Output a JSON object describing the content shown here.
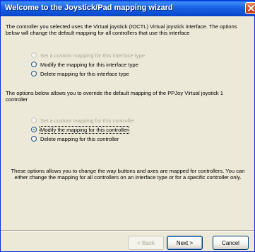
{
  "window": {
    "title": "Welcome to the Joystick/Pad mapping wizard"
  },
  "intro": {
    "text": "The controller you selected uses the Virtual joystick (IOCTL) Virtual joystick interface. The options below will change the default mapping for all controllers that use this interface"
  },
  "interface_options": [
    {
      "label": "Set a custom mapping for this interface type",
      "checked": false,
      "disabled": true
    },
    {
      "label": "Modify the mapping for this interface type",
      "checked": false,
      "disabled": false
    },
    {
      "label": "Delete mapping for this interface type",
      "checked": false,
      "disabled": false
    }
  ],
  "override": {
    "text": "The options below allows you to override the default mapping of the PPJoy Virtual joystick 1 controller"
  },
  "controller_options": [
    {
      "label": "Set a custom mapping for this controller",
      "checked": false,
      "disabled": true
    },
    {
      "label": "Modify the mapping for this controller",
      "checked": true,
      "disabled": false
    },
    {
      "label": "Delete mapping for this controller",
      "checked": false,
      "disabled": false
    }
  ],
  "info": {
    "text": "These options allows you to change the way buttons and axes are mapped for controllers. You can either change the mapping for all controllers on an interface type or for a specific controller only."
  },
  "buttons": {
    "back": "< Back",
    "next": "Next >",
    "cancel": "Cancel"
  },
  "icons": {
    "close": "close-icon"
  },
  "colors": {
    "titlebar": "#0a4ccf",
    "close": "#d9502c",
    "dialog": "#ece9d8"
  }
}
